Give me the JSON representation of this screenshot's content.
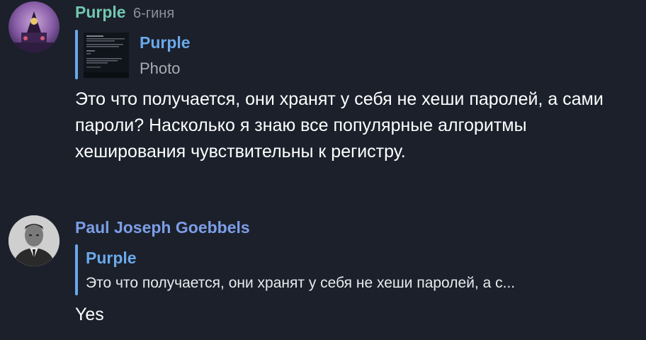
{
  "messages": [
    {
      "sender": "Purple",
      "time": "6-гиня",
      "sender_color": "#73c7b0",
      "avatar_icon": "purple-avatar-image",
      "reply": {
        "author": "Purple",
        "text": "Photo",
        "thumbnail_icon": "photo-thumbnail"
      },
      "body": "Это что получается, они хранят у себя не хеши паролей, а сами пароли? Насколько я знаю все популярные алгоритмы хеширования чувствительны к регистру."
    },
    {
      "sender": "Paul Joseph Goebbels",
      "sender_color": "#7c9ee6",
      "avatar_icon": "portrait-avatar-image",
      "reply": {
        "author": "Purple",
        "text": "Это что получается, они хранят у себя не хеши паролей, а с..."
      },
      "body": "Yes"
    }
  ],
  "colors": {
    "background": "#1b202b",
    "reply_accent": "#6aa9e9",
    "muted_text": "#8b919c"
  }
}
